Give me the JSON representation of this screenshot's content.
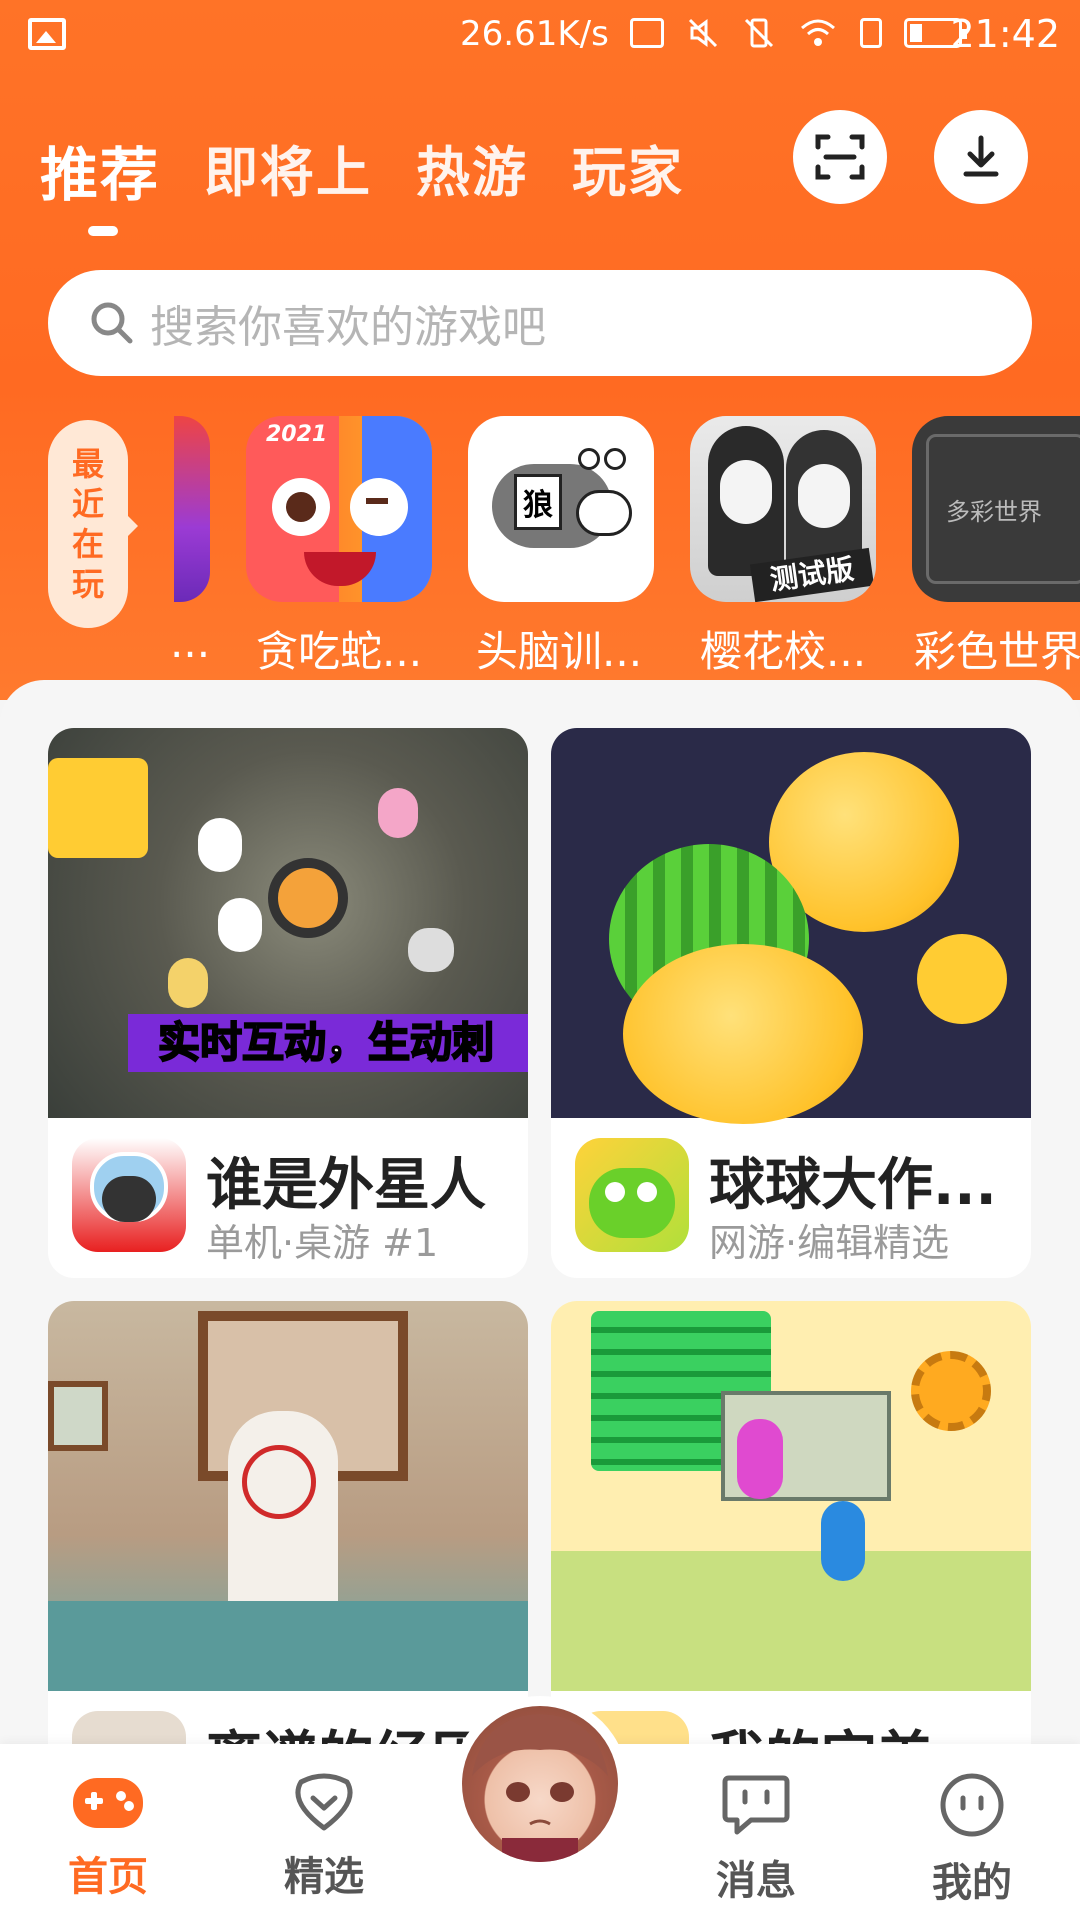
{
  "status_bar": {
    "speed": "26.61K/s",
    "time": "21:42"
  },
  "tabs": [
    {
      "label": "推荐",
      "active": true
    },
    {
      "label": "即将上",
      "active": false
    },
    {
      "label": "热游",
      "active": false
    },
    {
      "label": "玩家",
      "active": false
    }
  ],
  "search": {
    "placeholder": "搜索你喜欢的游戏吧"
  },
  "recent": {
    "label_chars": [
      "最",
      "近",
      "在",
      "玩"
    ],
    "partial_name": "...",
    "apps": [
      {
        "name": "贪吃蛇...",
        "badge": "2021"
      },
      {
        "name": "头脑训...",
        "badge": "狼"
      },
      {
        "name": "樱花校...",
        "badge": "测试版"
      },
      {
        "name": "彩色世界",
        "badge": "多彩世界"
      }
    ]
  },
  "cards": [
    {
      "title": "谁是外星人",
      "subtitle": "单机·桌游 #1",
      "banner": "实时互动，生动刺"
    },
    {
      "title": "球球大作...",
      "subtitle": "网游·编辑精选",
      "banner": ""
    },
    {
      "title": "离谱的经历",
      "subtitle": "",
      "banner": ""
    },
    {
      "title": "我的完美",
      "subtitle": "",
      "banner": ""
    }
  ],
  "bottom_nav": [
    {
      "label": "首页",
      "active": true,
      "icon": "gamepad-icon"
    },
    {
      "label": "精选",
      "active": false,
      "icon": "heart-icon"
    },
    {
      "label": "消息",
      "active": false,
      "icon": "chat-icon"
    },
    {
      "label": "我的",
      "active": false,
      "icon": "face-icon"
    }
  ],
  "colors": {
    "accent": "#ff6a22",
    "header": "#ff7327"
  }
}
